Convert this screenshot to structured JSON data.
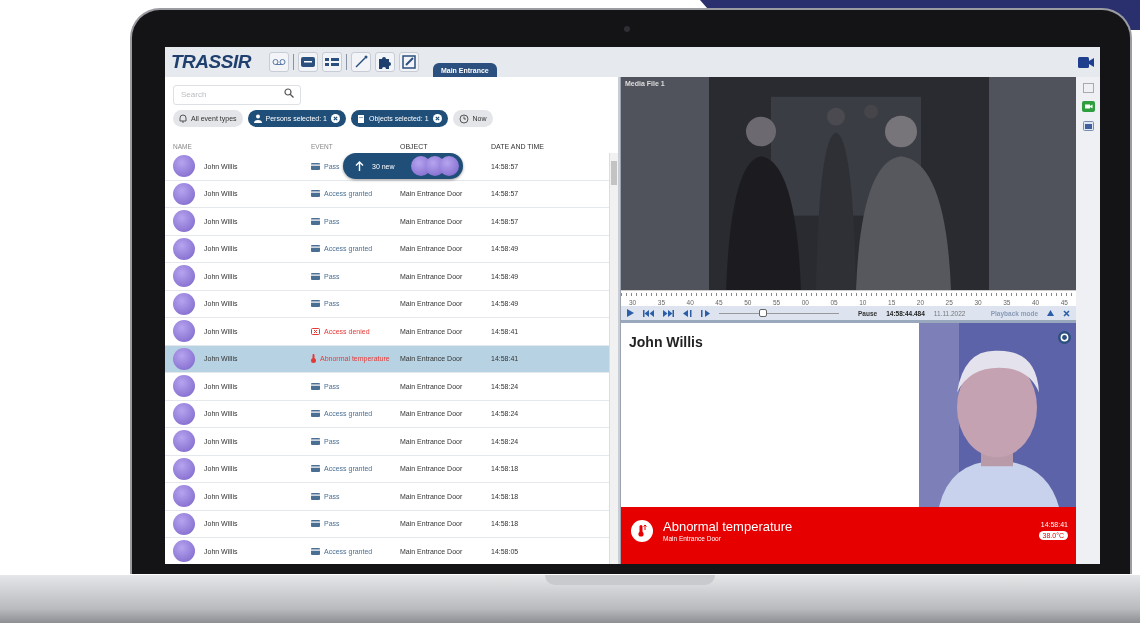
{
  "app": {
    "logo": "TRASSIR",
    "tab": {
      "label": "Main Entrance",
      "selected": true
    }
  },
  "search": {
    "placeholder": "Search"
  },
  "filters": [
    {
      "label": "All event types",
      "kind": "events",
      "selected": false
    },
    {
      "label": "Persons selected: 1",
      "kind": "persons",
      "selected": true
    },
    {
      "label": "Objects selected: 1",
      "kind": "objects",
      "selected": true
    },
    {
      "label": "Now",
      "kind": "time",
      "selected": false
    }
  ],
  "columns": [
    "NAME",
    "EVENT",
    "OBJECT",
    "DATE AND TIME"
  ],
  "new_popup": {
    "label": "30 new"
  },
  "rows": [
    {
      "name": "John Willis",
      "event": "Pass",
      "kind": "pass",
      "time": "14:58:57",
      "selected": false
    },
    {
      "name": "John Willis",
      "event": "Access granted",
      "kind": "pass",
      "object": "Main Entrance Door",
      "time": "14:58:57",
      "selected": false
    },
    {
      "name": "John Willis",
      "event": "Pass",
      "kind": "pass",
      "object": "Main Entrance Door",
      "time": "14:58:57",
      "selected": false
    },
    {
      "name": "John Willis",
      "event": "Access granted",
      "kind": "pass",
      "object": "Main Entrance Door",
      "time": "14:58:49",
      "selected": false
    },
    {
      "name": "John Willis",
      "event": "Pass",
      "kind": "pass",
      "object": "Main Entrance Door",
      "time": "14:58:49",
      "selected": false
    },
    {
      "name": "John Willis",
      "event": "Pass",
      "kind": "pass",
      "object": "Main Entrance Door",
      "time": "14:58:49",
      "selected": false
    },
    {
      "name": "John Willis",
      "event": "Access denied",
      "kind": "denied",
      "object": "Main Entrance Door",
      "time": "14:58:41",
      "selected": false
    },
    {
      "name": "John Willis",
      "event": "Abnormal temperature",
      "kind": "temperature",
      "object": "Main Entrance Door",
      "time": "14:58:41",
      "selected": true
    },
    {
      "name": "John Willis",
      "event": "Pass",
      "kind": "pass",
      "object": "Main Entrance Door",
      "time": "14:58:24",
      "selected": false
    },
    {
      "name": "John Willis",
      "event": "Access granted",
      "kind": "pass",
      "object": "Main Entrance Door",
      "time": "14:58:24",
      "selected": false
    },
    {
      "name": "John Willis",
      "event": "Pass",
      "kind": "pass",
      "object": "Main Entrance Door",
      "time": "14:58:24",
      "selected": false
    },
    {
      "name": "John Willis",
      "event": "Access granted",
      "kind": "pass",
      "object": "Main Entrance Door",
      "time": "14:58:18",
      "selected": false
    },
    {
      "name": "John Willis",
      "event": "Pass",
      "kind": "pass",
      "object": "Main Entrance Door",
      "time": "14:58:18",
      "selected": false
    },
    {
      "name": "John Willis",
      "event": "Pass",
      "kind": "pass",
      "object": "Main Entrance Door",
      "time": "14:58:18",
      "selected": false
    },
    {
      "name": "John Willis",
      "event": "Access granted",
      "kind": "pass",
      "object": "Main Entrance Door",
      "time": "14:58:05",
      "selected": false
    }
  ],
  "video": {
    "title": "Media File 1"
  },
  "timeline": {
    "ticks": [
      "30",
      "35",
      "40",
      "45",
      "50",
      "55",
      "00",
      "05",
      "10",
      "15",
      "20",
      "25",
      "30",
      "35",
      "40",
      "45"
    ]
  },
  "playback": {
    "status": "Pause",
    "time": "14:58:44.484",
    "date": "11.11.2022",
    "mode": "Playback mode",
    "level": 0.37
  },
  "person": {
    "name": "John Willis"
  },
  "alert": {
    "title": "Abnormal temperature",
    "subtitle": "Main Entrance Door",
    "time": "14:58:41",
    "temperature": "38.0°C"
  }
}
